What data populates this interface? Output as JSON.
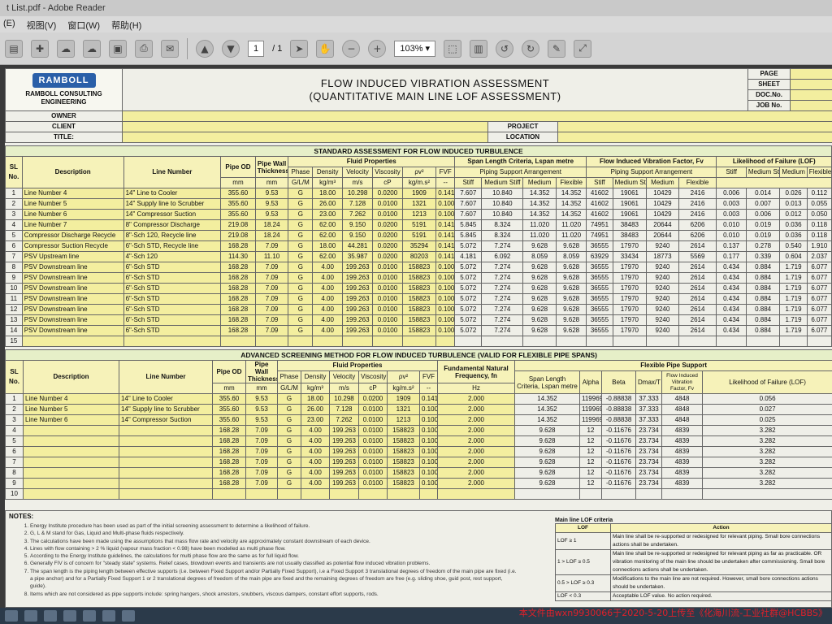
{
  "window": {
    "title": "t List.pdf - Adobe Reader"
  },
  "menu": [
    "(E)",
    "视图(V)",
    "窗口(W)",
    "帮助(H)"
  ],
  "toolbar": {
    "page_current": "1",
    "page_total": "/ 1",
    "zoom": "103%"
  },
  "header": {
    "logo_text": "RAMBOLL",
    "company": "RAMBOLL CONSULTING ENGINEERING",
    "title_line1": "FLOW INDUCED VIBRATION ASSESSMENT",
    "title_line2": "(QUANTITATIVE MAIN LINE LOF ASSESSMENT)",
    "owner_label": "OWNER",
    "client_label": "CLIENT",
    "title_label": "TITLE:",
    "project_label": "PROJECT",
    "location_label": "LOCATION",
    "page_label": "PAGE",
    "sheet_label": "SHEET",
    "doc_label": "DOC.No.",
    "job_label": "JOB No."
  },
  "standard": {
    "section_title": "STANDARD ASSESSMENT FOR FLOW INDUCED TURBULENCE",
    "h_sl": "SL No.",
    "h_desc": "Description",
    "h_line": "Line Number",
    "h_od": "Pipe OD",
    "h_wall": "Pipe Wall Thickness",
    "h_fluid": "Fluid Properties",
    "h_phase": "Phase",
    "h_density": "Density",
    "h_velocity": "Velocity",
    "h_visc": "Viscosity",
    "h_rhov2": "ρv²",
    "h_fvf": "FVF",
    "h_span": "Span Length Criteria, Lspan metre",
    "h_psa": "Piping Support Arrangement",
    "h_fv": "Flow Induced Vibration Factor, Fv",
    "h_lof": "Likelihood of Failure (LOF)",
    "h_stiff": "Stiff",
    "h_mstiff": "Medium Stiff",
    "h_medium": "Medium",
    "h_flex": "Flexible",
    "u_mm": "mm",
    "u_phase": "G/L/M",
    "u_density": "kg/m³",
    "u_velocity": "m/s",
    "u_visc": "cP",
    "u_rhov2": "kg/m.s²",
    "u_fvf": "--",
    "rows": [
      [
        "1",
        "Line Number 4",
        "14\" Line to Cooler",
        "355.60",
        "9.53",
        "G",
        "18.00",
        "10.298",
        "0.0200",
        "1909",
        "0.141",
        "7.607",
        "10.840",
        "14.352",
        "14.352",
        "41602",
        "19061",
        "10429",
        "2416",
        "0.006",
        "0.014",
        "0.026",
        "0.112"
      ],
      [
        "2",
        "Line Number 5",
        "14\" Supply line to Scrubber",
        "355.60",
        "9.53",
        "G",
        "26.00",
        "7.128",
        "0.0100",
        "1321",
        "0.100",
        "7.607",
        "10.840",
        "14.352",
        "14.352",
        "41602",
        "19061",
        "10429",
        "2416",
        "0.003",
        "0.007",
        "0.013",
        "0.055"
      ],
      [
        "3",
        "Line Number 6",
        "14\" Compressor Suction",
        "355.60",
        "9.53",
        "G",
        "23.00",
        "7.262",
        "0.0100",
        "1213",
        "0.100",
        "7.607",
        "10.840",
        "14.352",
        "14.352",
        "41602",
        "19061",
        "10429",
        "2416",
        "0.003",
        "0.006",
        "0.012",
        "0.050"
      ],
      [
        "4",
        "Line Number 7",
        "8\" Compressor Discharge",
        "219.08",
        "18.24",
        "G",
        "62.00",
        "9.150",
        "0.0200",
        "5191",
        "0.141",
        "5.845",
        "8.324",
        "11.020",
        "11.020",
        "74951",
        "38483",
        "20644",
        "6206",
        "0.010",
        "0.019",
        "0.036",
        "0.118"
      ],
      [
        "5",
        "Compressor Discharge Recycle",
        "8\"-Sch 120, Recycle line",
        "219.08",
        "18.24",
        "G",
        "62.00",
        "9.150",
        "0.0200",
        "5191",
        "0.141",
        "5.845",
        "8.324",
        "11.020",
        "11.020",
        "74951",
        "38483",
        "20644",
        "6206",
        "0.010",
        "0.019",
        "0.036",
        "0.118"
      ],
      [
        "6",
        "Compressor Suction Recycle",
        "6\"-Sch STD, Recycle line",
        "168.28",
        "7.09",
        "G",
        "18.00",
        "44.281",
        "0.0200",
        "35294",
        "0.141",
        "5.072",
        "7.274",
        "9.628",
        "9.628",
        "36555",
        "17970",
        "9240",
        "2614",
        "0.137",
        "0.278",
        "0.540",
        "1.910"
      ],
      [
        "7",
        "PSV Upstream line",
        "4\"-Sch 120",
        "114.30",
        "11.10",
        "G",
        "62.00",
        "35.987",
        "0.0200",
        "80203",
        "0.141",
        "4.181",
        "6.092",
        "8.059",
        "8.059",
        "63929",
        "33434",
        "18773",
        "5569",
        "0.177",
        "0.339",
        "0.604",
        "2.037"
      ],
      [
        "8",
        "PSV Downstream line",
        "6\"-Sch STD",
        "168.28",
        "7.09",
        "G",
        "4.00",
        "199.263",
        "0.0100",
        "158823",
        "0.100",
        "5.072",
        "7.274",
        "9.628",
        "9.628",
        "36555",
        "17970",
        "9240",
        "2614",
        "0.434",
        "0.884",
        "1.719",
        "6.077"
      ],
      [
        "9",
        "PSV Downstream line",
        "6\"-Sch STD",
        "168.28",
        "7.09",
        "G",
        "4.00",
        "199.263",
        "0.0100",
        "158823",
        "0.100",
        "5.072",
        "7.274",
        "9.628",
        "9.628",
        "36555",
        "17970",
        "9240",
        "2614",
        "0.434",
        "0.884",
        "1.719",
        "6.077"
      ],
      [
        "10",
        "PSV Downstream line",
        "6\"-Sch STD",
        "168.28",
        "7.09",
        "G",
        "4.00",
        "199.263",
        "0.0100",
        "158823",
        "0.100",
        "5.072",
        "7.274",
        "9.628",
        "9.628",
        "36555",
        "17970",
        "9240",
        "2614",
        "0.434",
        "0.884",
        "1.719",
        "6.077"
      ],
      [
        "11",
        "PSV Downstream line",
        "6\"-Sch STD",
        "168.28",
        "7.09",
        "G",
        "4.00",
        "199.263",
        "0.0100",
        "158823",
        "0.100",
        "5.072",
        "7.274",
        "9.628",
        "9.628",
        "36555",
        "17970",
        "9240",
        "2614",
        "0.434",
        "0.884",
        "1.719",
        "6.077"
      ],
      [
        "12",
        "PSV Downstream line",
        "6\"-Sch STD",
        "168.28",
        "7.09",
        "G",
        "4.00",
        "199.263",
        "0.0100",
        "158823",
        "0.100",
        "5.072",
        "7.274",
        "9.628",
        "9.628",
        "36555",
        "17970",
        "9240",
        "2614",
        "0.434",
        "0.884",
        "1.719",
        "6.077"
      ],
      [
        "13",
        "PSV Downstream line",
        "6\"-Sch STD",
        "168.28",
        "7.09",
        "G",
        "4.00",
        "199.263",
        "0.0100",
        "158823",
        "0.100",
        "5.072",
        "7.274",
        "9.628",
        "9.628",
        "36555",
        "17970",
        "9240",
        "2614",
        "0.434",
        "0.884",
        "1.719",
        "6.077"
      ],
      [
        "14",
        "PSV Downstream line",
        "6\"-Sch STD",
        "168.28",
        "7.09",
        "G",
        "4.00",
        "199.263",
        "0.0100",
        "158823",
        "0.100",
        "5.072",
        "7.274",
        "9.628",
        "9.628",
        "36555",
        "17970",
        "9240",
        "2614",
        "0.434",
        "0.884",
        "1.719",
        "6.077"
      ],
      [
        "15",
        "",
        "",
        "",
        "",
        "",
        "",
        "",
        "",
        "",
        "",
        "",
        "",
        "",
        "",
        "",
        "",
        "",
        "",
        "",
        "",
        "",
        ""
      ]
    ]
  },
  "advanced": {
    "section_title": "ADVANCED SCREENING METHOD FOR FLOW INDUCED TURBULENCE (VALID FOR FLEXIBLE PIPE SPANS)",
    "h_fnf": "Fundamental Natural Frequency, fn",
    "u_hz": "Hz",
    "h_fps": "Flexible Pipe Support",
    "h_slc": "Span Length Criteria, Lspan metre",
    "h_alpha": "Alpha",
    "h_beta": "Beta",
    "h_dmax": "Dmax/T",
    "h_fivf": "Flow Induced Vibration Factor, Fv",
    "h_lof": "Likelihood of Failure (LOF)",
    "rows": [
      [
        "1",
        "Line Number 4",
        "14\" Line to Cooler",
        "355.60",
        "9.53",
        "G",
        "18.00",
        "10.298",
        "0.0200",
        "1909",
        "0.141",
        "2.000",
        "14.352",
        "119969",
        "-0.88838",
        "37.333",
        "4848",
        "0.056"
      ],
      [
        "2",
        "Line Number 5",
        "14\" Supply line to Scrubber",
        "355.60",
        "9.53",
        "G",
        "26.00",
        "7.128",
        "0.0100",
        "1321",
        "0.100",
        "2.000",
        "14.352",
        "119969",
        "-0.88838",
        "37.333",
        "4848",
        "0.027"
      ],
      [
        "3",
        "Line Number 6",
        "14\" Compressor Suction",
        "355.60",
        "9.53",
        "G",
        "23.00",
        "7.262",
        "0.0100",
        "1213",
        "0.100",
        "2.000",
        "14.352",
        "119969",
        "-0.88838",
        "37.333",
        "4848",
        "0.025"
      ],
      [
        "4",
        "",
        "",
        "168.28",
        "7.09",
        "G",
        "4.00",
        "199.263",
        "0.0100",
        "158823",
        "0.100",
        "2.000",
        "9.628",
        "12",
        "-0.11676",
        "23.734",
        "4839",
        "3.282"
      ],
      [
        "5",
        "",
        "",
        "168.28",
        "7.09",
        "G",
        "4.00",
        "199.263",
        "0.0100",
        "158823",
        "0.100",
        "2.000",
        "9.628",
        "12",
        "-0.11676",
        "23.734",
        "4839",
        "3.282"
      ],
      [
        "6",
        "",
        "",
        "168.28",
        "7.09",
        "G",
        "4.00",
        "199.263",
        "0.0100",
        "158823",
        "0.100",
        "2.000",
        "9.628",
        "12",
        "-0.11676",
        "23.734",
        "4839",
        "3.282"
      ],
      [
        "7",
        "",
        "",
        "168.28",
        "7.09",
        "G",
        "4.00",
        "199.263",
        "0.0100",
        "158823",
        "0.100",
        "2.000",
        "9.628",
        "12",
        "-0.11676",
        "23.734",
        "4839",
        "3.282"
      ],
      [
        "8",
        "",
        "",
        "168.28",
        "7.09",
        "G",
        "4.00",
        "199.263",
        "0.0100",
        "158823",
        "0.100",
        "2.000",
        "9.628",
        "12",
        "-0.11676",
        "23.734",
        "4839",
        "3.282"
      ],
      [
        "9",
        "",
        "",
        "168.28",
        "7.09",
        "G",
        "4.00",
        "199.263",
        "0.0100",
        "158823",
        "0.100",
        "2.000",
        "9.628",
        "12",
        "-0.11676",
        "23.734",
        "4839",
        "3.282"
      ],
      [
        "10",
        "",
        "",
        "",
        "",
        "",
        "",
        "",
        "",
        "",
        "",
        "",
        "",
        "",
        "",
        "",
        "",
        ""
      ]
    ]
  },
  "notes": {
    "title": "NOTES:",
    "items": [
      "Energy Institute procedure has been used as part of the initial screening assessment to determine a likelihood of failure.",
      "G, L & M stand for Gas, Liquid and Multi-phase fluids respectively.",
      "The calculations have been made using the assumptions that mass flow rate and velocity are approximately constant downstream of each device.",
      "Lines with flow containing > 2 % liquid (vapour mass fraction < 0.98) have been modelled as multi phase flow.",
      "According to the Energy Institute guidelines, the calculations for multi phase flow are the same as for full liquid flow.",
      "Generally FIV is of concern for \"steady state\" systems. Relief cases, blowdown events and transients are not usually classified as potential flow induced vibration problems.",
      "The span length is the piping length between effective supports (i.e. between Fixed Support and/or Partially Fixed Support), i.e a Fixed Support 3 translational degrees of freedom of the main pipe are fixed (i.e. a pipe anchor) and for a Partially Fixed Support 1 or 2 translational degrees of freedom of the main pipe are fixed and the remaining degrees of freedom are free (e.g. sliding shoe, guid post, rest support, guide).",
      "Items which are not considered as pipe supports include: spring hangers, shock arrestors, snubbers, viscous dampers, constant effort supports, rods."
    ],
    "lof_title": "Main line LOF criteria",
    "lof_h1": "LOF",
    "lof_h2": "Action",
    "lof_rows": [
      [
        "LOF ≥ 1",
        "Main line shall be re-supported or redesigned for relevant piping. Small bore connections actions shall be undertaken."
      ],
      [
        "1 > LOF ≥ 0.5",
        "Main line shall be re-supported or redesigned for relevant piping as far as practicable. OR vibration monitoring of the main line should be undertaken after commissioning. Small bore connections actions shall be undertaken."
      ],
      [
        "0.5 > LOF ≥ 0.3",
        "Modifications to the main line are not required. However, small bore connections actions should be undertaken."
      ],
      [
        "LOF < 0.3",
        "Acceptable LOF value. No action required."
      ]
    ]
  },
  "watermark": "本文件由wxn9930066于2020-5-20上传至《化海川流-工业社群@HCBBS》"
}
